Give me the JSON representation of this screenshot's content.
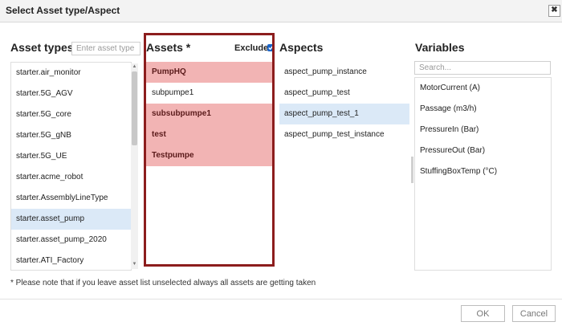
{
  "dialog": {
    "title": "Select Asset type/Aspect",
    "close_glyph": "✖"
  },
  "asset_types": {
    "title": "Asset types",
    "search_placeholder": "Enter asset type",
    "items": [
      {
        "label": "starter.air_monitor",
        "selected": false
      },
      {
        "label": "starter.5G_AGV",
        "selected": false
      },
      {
        "label": "starter.5G_core",
        "selected": false
      },
      {
        "label": "starter.5G_gNB",
        "selected": false
      },
      {
        "label": "starter.5G_UE",
        "selected": false
      },
      {
        "label": "starter.acme_robot",
        "selected": false
      },
      {
        "label": "starter.AssemblyLineType",
        "selected": false
      },
      {
        "label": "starter.asset_pump",
        "selected": true
      },
      {
        "label": "starter.asset_pump_2020",
        "selected": false
      },
      {
        "label": "starter.ATI_Factory",
        "selected": false
      }
    ]
  },
  "assets": {
    "title": "Assets *",
    "exclude_label": "Exclude",
    "exclude_checked": true,
    "items": [
      {
        "label": "PumpHQ",
        "flagged": true
      },
      {
        "label": "subpumpe1",
        "flagged": false
      },
      {
        "label": "subsubpumpe1",
        "flagged": true
      },
      {
        "label": "test",
        "flagged": true
      },
      {
        "label": "Testpumpe",
        "flagged": true
      }
    ]
  },
  "aspects": {
    "title": "Aspects",
    "items": [
      {
        "label": "aspect_pump_instance",
        "selected": false
      },
      {
        "label": "aspect_pump_test",
        "selected": false
      },
      {
        "label": "aspect_pump_test_1",
        "selected": true
      },
      {
        "label": "aspect_pump_test_instance",
        "selected": false
      }
    ]
  },
  "variables": {
    "title": "Variables",
    "search_placeholder": "Search...",
    "items": [
      {
        "label": "MotorCurrent (A)"
      },
      {
        "label": "Passage (m3/h)"
      },
      {
        "label": "PressureIn (Bar)"
      },
      {
        "label": "PressureOut (Bar)"
      },
      {
        "label": "StuffingBoxTemp (°C)"
      }
    ]
  },
  "note": "* Please note that if you leave asset list unselected always all assets are getting taken",
  "buttons": {
    "ok": "OK",
    "cancel": "Cancel"
  },
  "colors": {
    "selected_row": "#dbe9f7",
    "flagged_row": "#f2b4b4",
    "highlight_border": "#8c1d1d"
  }
}
